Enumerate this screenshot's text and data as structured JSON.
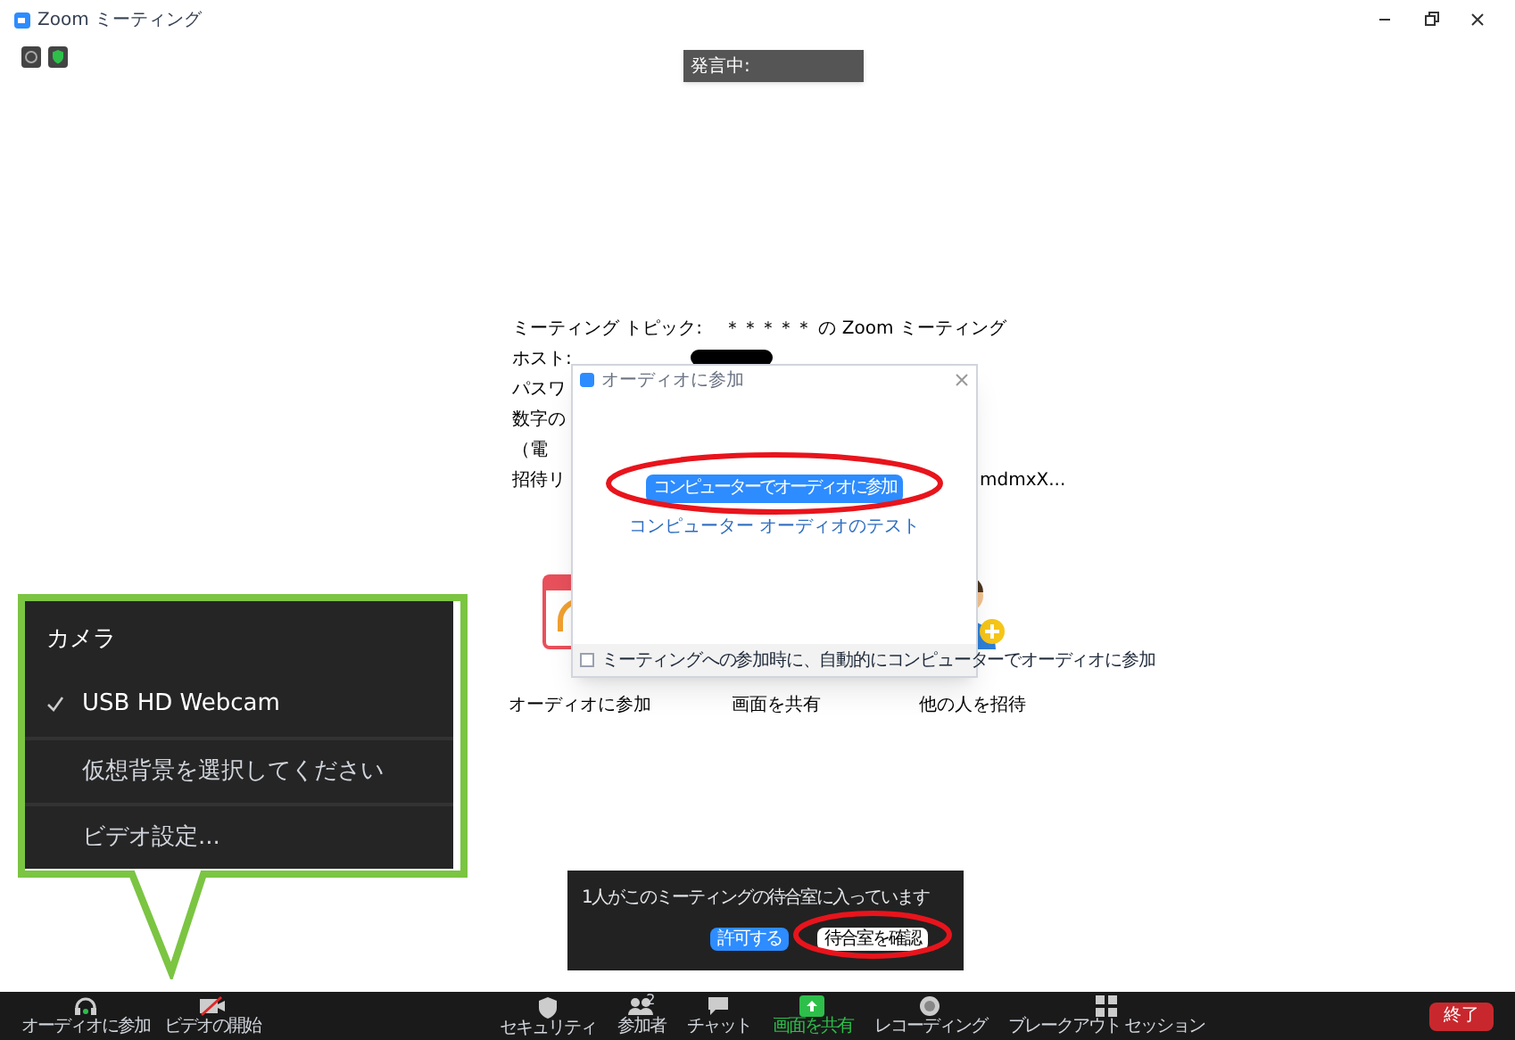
{
  "window": {
    "title": "Zoom ミーティング"
  },
  "speaking_label": "発言中:",
  "meeting_info": [
    {
      "label": "ミーティング トピック:",
      "value": "＊＊＊＊＊ の Zoom ミーティング",
      "kind": "text"
    },
    {
      "label": "ホスト:",
      "kind": "redacted"
    },
    {
      "label": "パスワ",
      "kind": "none"
    },
    {
      "label": "数字の",
      "kind": "none"
    },
    {
      "label": "（電",
      "kind": "none"
    },
    {
      "label": "招待リ",
      "value": "mdmxX...",
      "kind": "text"
    }
  ],
  "actions": [
    {
      "label": "オーディオに参加",
      "kind": "audio"
    },
    {
      "label": "画面を共有",
      "kind": "share"
    },
    {
      "label": "他の人を招待",
      "kind": "invite"
    }
  ],
  "audio_dialog": {
    "title": "オーディオに参加",
    "join_button": "コンピューターでオーディオに参加",
    "test_link": "コンピューター オーディオのテスト",
    "auto_join": {
      "label": "ミーティングへの参加時に、自動的にコンピューターでオーディオに参加",
      "checked": false
    }
  },
  "camera_menu": {
    "heading": "カメラ",
    "items": [
      {
        "label": "USB HD Webcam",
        "checked": true
      },
      {
        "label": "仮想背景を選択してください",
        "checked": false
      },
      {
        "label": "ビデオ設定...",
        "checked": false
      }
    ]
  },
  "waiting_room": {
    "message": "1人がこのミーティングの待合室に入っています",
    "buttons": [
      {
        "label": "許可する",
        "kind": "primary"
      },
      {
        "label": "待合室を確認",
        "kind": "secondary"
      }
    ]
  },
  "toolbar": {
    "left": [
      {
        "label": "オーディオに参加",
        "kind": "audio"
      },
      {
        "label": "ビデオの開始",
        "kind": "video"
      }
    ],
    "center": [
      {
        "label": "セキュリティ",
        "kind": "security"
      },
      {
        "label": "参加者",
        "kind": "participants",
        "count": "2"
      },
      {
        "label": "チャット",
        "kind": "chat"
      },
      {
        "label": "画面を共有",
        "kind": "share"
      },
      {
        "label": "レコーディング",
        "kind": "record"
      },
      {
        "label": "ブレークアウト セッション",
        "kind": "breakout"
      }
    ],
    "end_button": "終了"
  }
}
